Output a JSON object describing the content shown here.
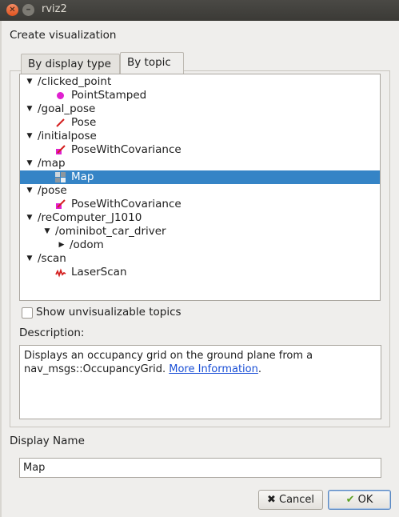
{
  "window": {
    "title": "rviz2"
  },
  "header": {
    "label": "Create visualization"
  },
  "tabs": [
    {
      "label": "By display type",
      "active": false
    },
    {
      "label": "By topic",
      "active": true
    }
  ],
  "tree": {
    "rows": [
      {
        "text": "/clicked_point",
        "level": 0,
        "expanded": true,
        "icon": null
      },
      {
        "text": "PointStamped",
        "level": 1,
        "icon": "point-stamped-icon"
      },
      {
        "text": "/goal_pose",
        "level": 0,
        "expanded": true,
        "icon": null
      },
      {
        "text": "Pose",
        "level": 1,
        "icon": "pose-icon"
      },
      {
        "text": "/initialpose",
        "level": 0,
        "expanded": true,
        "icon": null
      },
      {
        "text": "PoseWithCovariance",
        "level": 1,
        "icon": "pose-with-covariance-icon"
      },
      {
        "text": "/map",
        "level": 0,
        "expanded": true,
        "icon": null
      },
      {
        "text": "Map",
        "level": 1,
        "icon": "map-icon",
        "selected": true
      },
      {
        "text": "/pose",
        "level": 0,
        "expanded": true,
        "icon": null
      },
      {
        "text": "PoseWithCovariance",
        "level": 1,
        "icon": "pose-with-covariance-icon"
      },
      {
        "text": "/reComputer_J1010",
        "level": 0,
        "expanded": true,
        "icon": null
      },
      {
        "text": "/ominibot_car_driver",
        "level": 1,
        "expanded": true,
        "icon": null
      },
      {
        "text": "/odom",
        "level": 2,
        "expanded": false,
        "icon": null
      },
      {
        "text": "/scan",
        "level": 0,
        "expanded": true,
        "icon": null
      },
      {
        "text": "LaserScan",
        "level": 1,
        "icon": "laser-scan-icon"
      }
    ]
  },
  "show_unvisualizable": {
    "label": "Show unvisualizable topics",
    "checked": false
  },
  "description": {
    "label": "Description:",
    "text": "Displays an occupancy grid on the ground plane from a nav_msgs::OccupancyGrid.",
    "link": "More Information",
    "suffix": "."
  },
  "display_name": {
    "label": "Display Name",
    "value": "Map"
  },
  "buttons": {
    "cancel": "Cancel",
    "ok": "OK"
  },
  "colors": {
    "selection": "#3584c6",
    "accent_magenta": "#e020d0",
    "pose_red": "#d42020",
    "link": "#1a4fd6"
  }
}
